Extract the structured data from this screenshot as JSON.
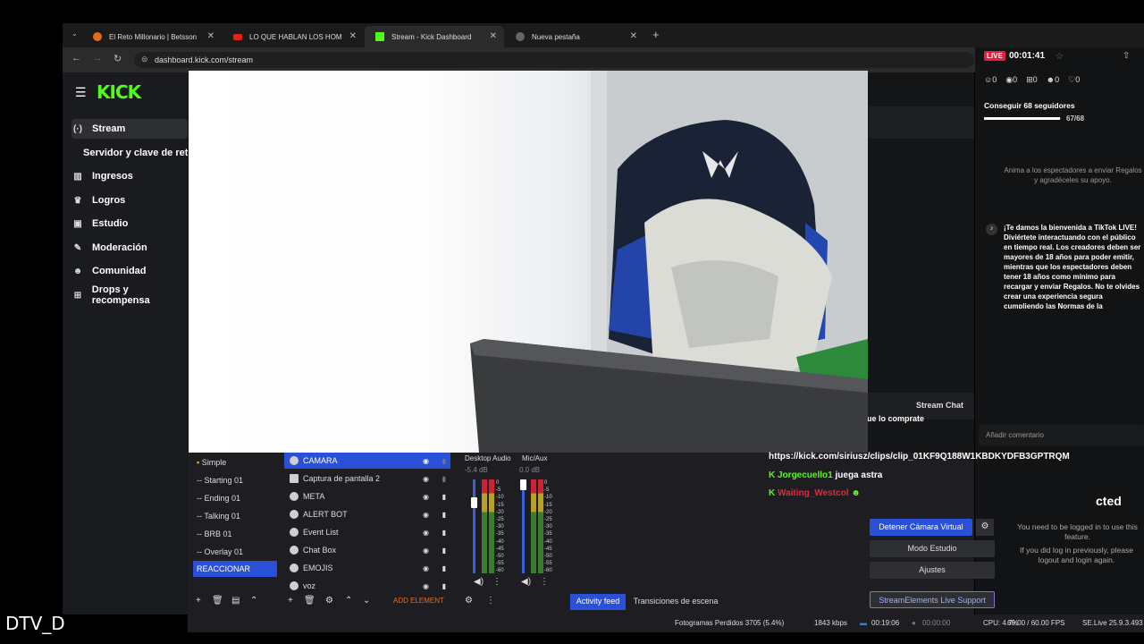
{
  "browser": {
    "tabs": [
      {
        "title": "El Reto Millonario | Betsson"
      },
      {
        "title": "LO QUE HABLAN LOS HOM"
      },
      {
        "title": "Stream - Kick Dashboard"
      },
      {
        "title": "Nueva pestaña"
      }
    ],
    "url": "dashboard.kick.com/stream"
  },
  "kick": {
    "logo": "KICK",
    "sidebar": [
      {
        "label": "Stream",
        "icon": "broadcast-icon"
      },
      {
        "label": "Servidor y clave de retr",
        "icon": ""
      },
      {
        "label": "Ingresos",
        "icon": "chart-icon"
      },
      {
        "label": "Logros",
        "icon": "trophy-icon"
      },
      {
        "label": "Estudio",
        "icon": "studio-icon"
      },
      {
        "label": "Moderación",
        "icon": "wrench-icon"
      },
      {
        "label": "Comunidad",
        "icon": "people-icon"
      },
      {
        "label": "Drops y recompensa",
        "icon": "gift-icon"
      }
    ],
    "stream_chat_label": "Stream Chat",
    "chat_partial": "ue lo comprate",
    "add_comment_placeholder": "Añadir comentario"
  },
  "live_panel": {
    "badge": "LIVE",
    "timer": "00:01:41",
    "stats": [
      "0",
      "0",
      "0",
      "0",
      "0"
    ],
    "goal_label": "Conseguir 68 seguidores",
    "goal_progress": "67/68",
    "goal_fraction": 0.985,
    "hint": "Anima a los espectadores a enviar Regalos y agradéceles su apoyo.",
    "welcome": "¡Te damos la bienvenida a TikTok LIVE! Diviértete interactuando con el público en tiempo real. Los creadores deben ser mayores de 18 años para poder emitir, mientras que los espectadores deben tener 18 años como mínimo para recargar y enviar Regalos. No te olvides crear una experiencia segura cumpliendo las Normas de la comunidad.",
    "login_partial": "cted",
    "login_msg": "You need to be logged in to use this feature.",
    "login_msg2": "If you did log in previously, please logout and login again."
  },
  "chat": {
    "link": "https://kick.com/siriusz/clips/clip_01KF9Q188W1KBDKYDFB3GPTRQM",
    "msg1_user": "Jorgecuello1",
    "msg1_text": "juega astra",
    "msg2_user": "Waiting_Westcol",
    "user1_color": "#53fc18",
    "user2_color": "#e0283c"
  },
  "obs": {
    "scenes": [
      "Simple",
      "-- Starting 01",
      "-- Ending 01",
      "-- Talking 01",
      "-- BRB 01",
      "-- Overlay 01",
      "REACCIONAR"
    ],
    "sources": [
      "CAMARA",
      "Captura de pantalla 2",
      "META",
      "ALERT BOT",
      "Event List",
      "Chat Box",
      "EMOJIS",
      "voz"
    ],
    "add_element": "ADD ELEMENT",
    "audio": [
      {
        "name": "Desktop Audio",
        "db": "-5.4 dB"
      },
      {
        "name": "Mic/Aux",
        "db": "0.0 dB"
      }
    ],
    "meter_ticks": [
      "0",
      "-5",
      "-10",
      "-15",
      "-20",
      "-25",
      "-30",
      "-35",
      "-40",
      "-45",
      "-50",
      "-55",
      "-60"
    ],
    "tabs": [
      "Activity feed",
      "Transiciones de escena"
    ],
    "buttons": [
      "Detener Cámara Virtual",
      "Modo Estudio",
      "Ajustes",
      "StreamElements Live Support"
    ],
    "status": {
      "dropped": "Fotogramas Perdidos 3705 (5.4%)",
      "bitrate": "1843 kbps",
      "stream_time": "00:19:06",
      "rec_time": "00:00:00",
      "cpu": "CPU: 4.7%",
      "fps": "60.00 / 60.00 FPS",
      "version": "SE.Live 25.9.3.493"
    }
  },
  "watermark": "DTV_D",
  "colors": {
    "kick_green": "#53fc18",
    "obs_blue": "#2a50d8",
    "live_red": "#e91e3c"
  }
}
